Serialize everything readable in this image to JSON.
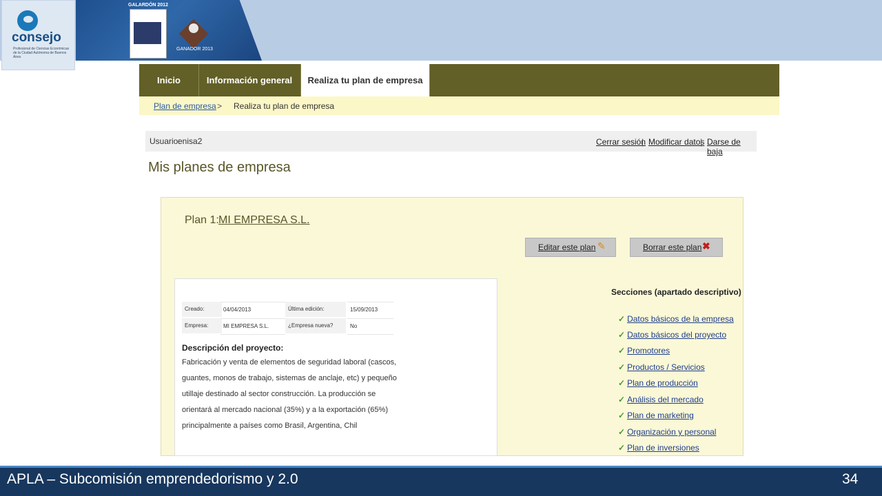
{
  "header": {
    "logo_word": "consejo",
    "logo_subtitle": "Profesional de Ciencias Económicas de la Ciudad Autónoma de Buenos Aires",
    "award_title": "GALARDÓN 2012",
    "award2_title": "GANADOR 2013"
  },
  "nav": {
    "tabs": [
      "Inicio",
      "Información general",
      "Realiza tu plan de empresa"
    ],
    "active_tab": "Realiza tu plan de empresa"
  },
  "breadcrumb": {
    "link": "Plan de empresa",
    "separator": ">",
    "current": "Realiza tu plan de empresa"
  },
  "user": {
    "label": "Usuario:",
    "name": "enisa2",
    "links": [
      "Cerrar sesión",
      "Modificar datos",
      "Darse de baja"
    ],
    "separator": "|"
  },
  "page_title": "Mis planes de empresa",
  "plan": {
    "label": "Plan 1:",
    "name": "MI EMPRESA S.L.",
    "edit_button": "Editar este plan",
    "delete_button": "Borrar este plan",
    "edit_icon": "pencil-icon",
    "delete_icon": "close-x-icon"
  },
  "meta": {
    "created_label": "Creado:",
    "created_value": "04/04/2013",
    "edited_label": "Última edición:",
    "edited_value": "15/09/2013",
    "company_label": "Empresa:",
    "company_value": "MI EMPRESA S.L.",
    "new_label": "¿Empresa nueva?",
    "new_value": "No"
  },
  "description": {
    "title": "Descripción del proyecto:",
    "lines": [
      "Fabricación y venta de elementos de seguridad laboral (cascos,",
      "guantes, monos de trabajo, sistemas de anclaje, etc) y pequeño",
      "utillaje destinado al sector construcción. La producción se",
      "orientará al mercado nacional (35%) y a la exportación (65%)",
      "principalmente a países como Brasil, Argentina, Chil"
    ]
  },
  "sections": {
    "title": "Secciones (apartado descriptivo)",
    "items": [
      "Datos básicos de la empresa",
      "Datos básicos del proyecto",
      "Promotores",
      "Productos / Servicios",
      "Plan de producción",
      "Análisis del mercado",
      "Plan de marketing",
      "Organización y personal",
      "Plan de inversiones"
    ],
    "check_color": "#4c9a2a"
  },
  "footer": {
    "text": "APLA – Subcomisión emprendedorismo y 2.0",
    "slide_number": "34"
  }
}
